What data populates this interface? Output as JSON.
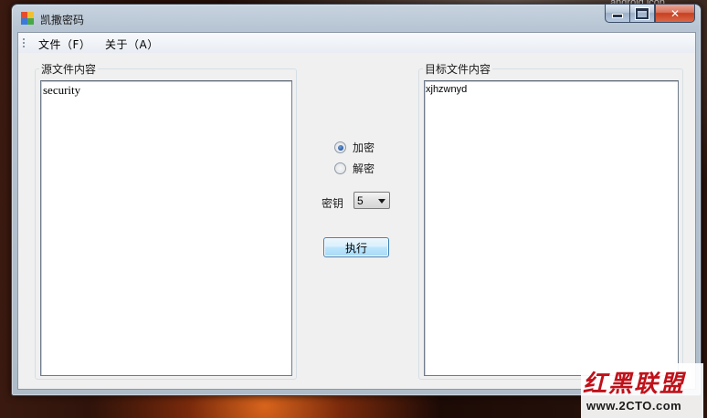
{
  "window": {
    "title": "凯撒密码",
    "background_caption": "android icon"
  },
  "menu": {
    "items": [
      {
        "label": "文件（F）"
      },
      {
        "label": "关于（A）"
      }
    ]
  },
  "source": {
    "label": "源文件内容",
    "content": "security"
  },
  "target": {
    "label": "目标文件内容",
    "content": "xjhzwnyd"
  },
  "mode": {
    "options": [
      {
        "label": "加密",
        "selected": true
      },
      {
        "label": "解密",
        "selected": false
      }
    ]
  },
  "key": {
    "label": "密钥",
    "value": "5"
  },
  "execute": {
    "label": "执行"
  },
  "watermark": {
    "chinese": "红黑联盟",
    "url": "www.2CTO.com"
  },
  "colors": {
    "close_button": "#c7401f",
    "radio_dot": "#1f4f97",
    "logo_red": "#c0111a"
  }
}
